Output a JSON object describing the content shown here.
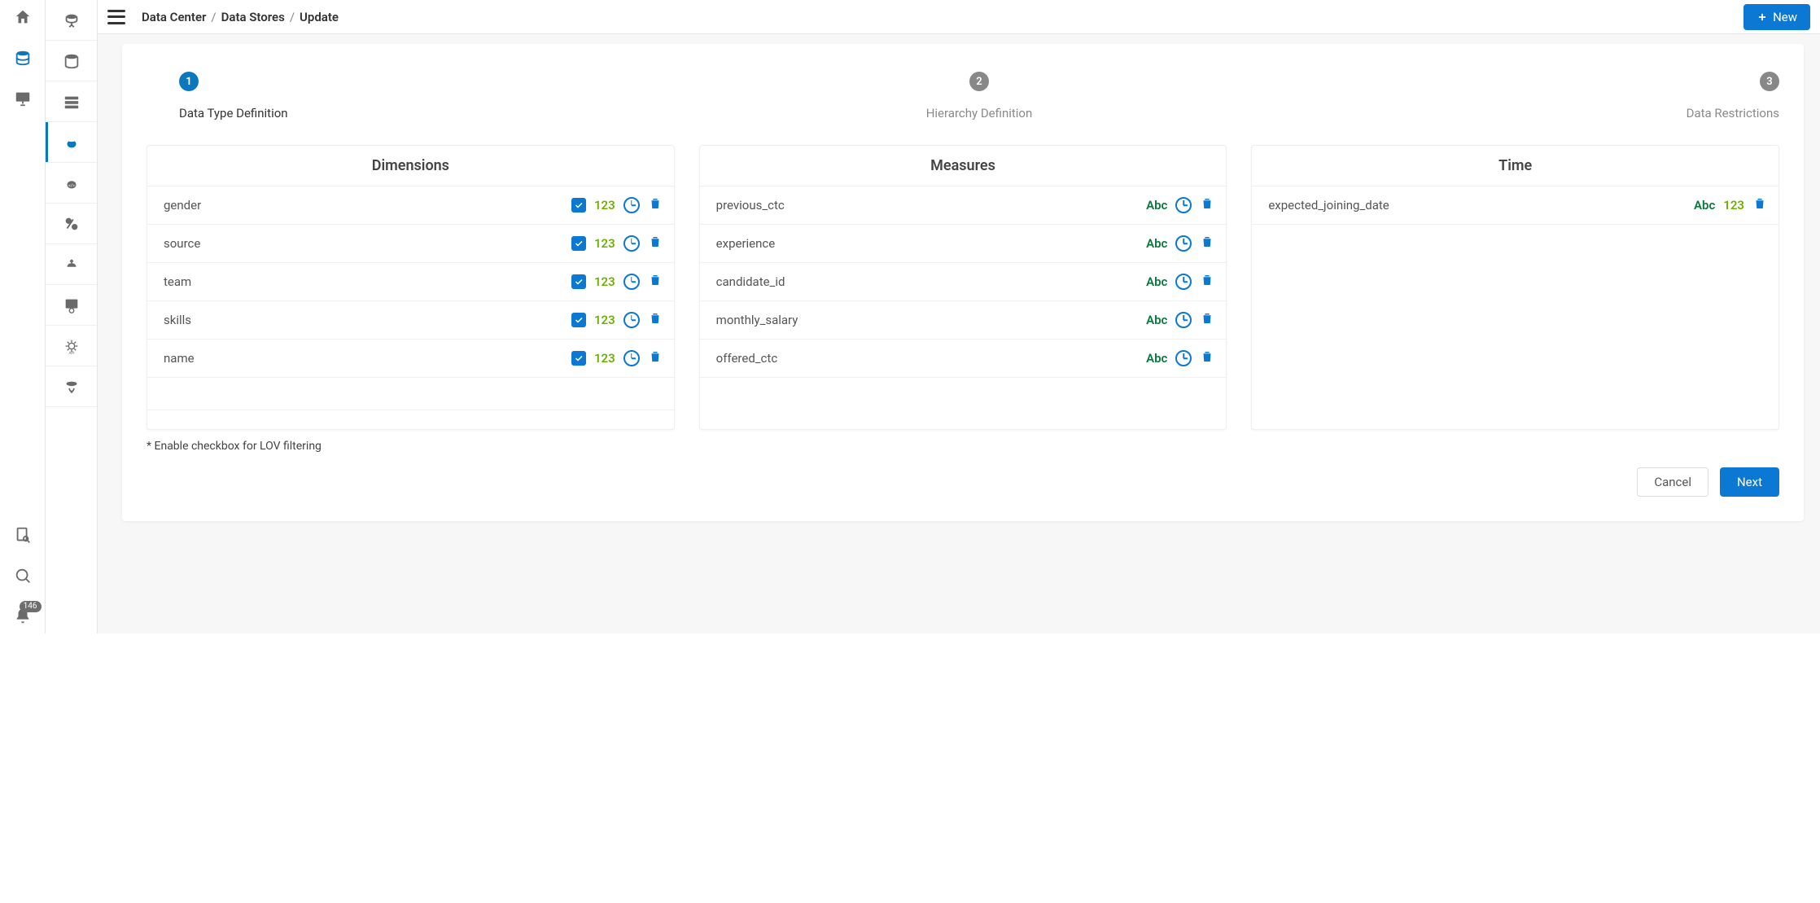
{
  "rail": {
    "notification_count": "146"
  },
  "breadcrumb": {
    "a": "Data Center",
    "b": "Data Stores",
    "c": "Update"
  },
  "buttons": {
    "new": "New",
    "cancel": "Cancel",
    "next": "Next"
  },
  "stepper": {
    "s1": {
      "num": "1",
      "label": "Data Type Definition"
    },
    "s2": {
      "num": "2",
      "label": "Hierarchy Definition"
    },
    "s3": {
      "num": "3",
      "label": "Data Restrictions"
    }
  },
  "columns": {
    "dimensions": {
      "title": "Dimensions"
    },
    "measures": {
      "title": "Measures"
    },
    "time": {
      "title": "Time"
    }
  },
  "tags": {
    "num": "123",
    "str": "Abc"
  },
  "dimensions": {
    "r0": "gender",
    "r1": "source",
    "r2": "team",
    "r3": "skills",
    "r4": "name"
  },
  "measures": {
    "r0": "previous_ctc",
    "r1": "experience",
    "r2": "candidate_id",
    "r3": "monthly_salary",
    "r4": "offered_ctc"
  },
  "time": {
    "r0": "expected_joining_date"
  },
  "footnote": "* Enable checkbox for LOV filtering"
}
